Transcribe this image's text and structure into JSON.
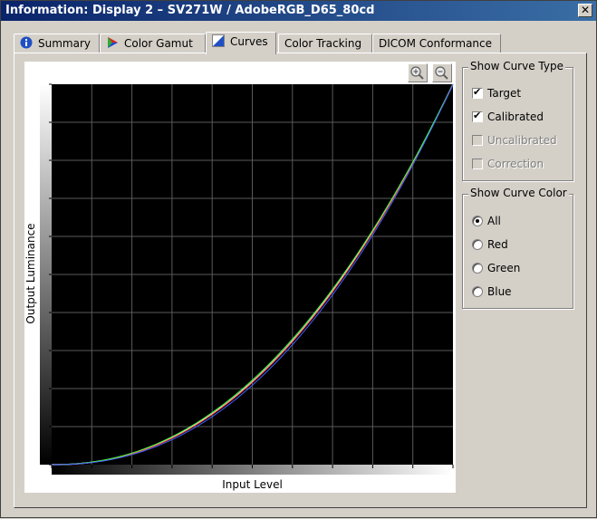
{
  "window": {
    "title": "Information: Display 2 – SV271W / AdobeRGB_D65_80cd",
    "close_glyph": "✕"
  },
  "tabs": [
    {
      "label": "Summary",
      "icon": "info-icon",
      "active": false
    },
    {
      "label": "Color Gamut",
      "icon": "color-gamut-icon",
      "active": false
    },
    {
      "label": "Curves",
      "icon": "curves-icon",
      "active": true
    },
    {
      "label": "Color Tracking",
      "icon": "",
      "active": false
    },
    {
      "label": "DICOM Conformance",
      "icon": "",
      "active": false
    }
  ],
  "plot": {
    "zoom_in_icon": "zoom-in-icon",
    "zoom_out_icon": "zoom-out-icon",
    "background": "#000000",
    "grid_color": "#5a5a5a"
  },
  "chart_data": {
    "type": "line",
    "xlabel": "Input Level",
    "ylabel": "Output Luminance",
    "xlim": [
      0,
      1
    ],
    "ylim": [
      0,
      1
    ],
    "grid": true,
    "series": [
      {
        "color": "#ffffff",
        "gamma": 2.2,
        "x": [
          0,
          0.1,
          0.2,
          0.3,
          0.4,
          0.5,
          0.6,
          0.7,
          0.8,
          0.9,
          1.0
        ],
        "y": [
          0.0,
          0.006,
          0.029,
          0.071,
          0.133,
          0.218,
          0.325,
          0.456,
          0.612,
          0.793,
          1.0
        ]
      },
      {
        "color": "#ff4040",
        "gamma": 2.21,
        "x": [
          0,
          0.1,
          0.2,
          0.3,
          0.4,
          0.5,
          0.6,
          0.7,
          0.8,
          0.9,
          1.0
        ],
        "y": [
          0.0,
          0.006,
          0.029,
          0.07,
          0.132,
          0.216,
          0.324,
          0.455,
          0.611,
          0.792,
          1.0
        ]
      },
      {
        "color": "#40ff40",
        "gamma": 2.17,
        "x": [
          0,
          0.1,
          0.2,
          0.3,
          0.4,
          0.5,
          0.6,
          0.7,
          0.8,
          0.9,
          1.0
        ],
        "y": [
          0.0,
          0.007,
          0.03,
          0.073,
          0.137,
          0.222,
          0.33,
          0.461,
          0.616,
          0.796,
          1.0
        ]
      },
      {
        "color": "#4060ff",
        "gamma": 2.26,
        "x": [
          0,
          0.1,
          0.2,
          0.3,
          0.4,
          0.5,
          0.6,
          0.7,
          0.8,
          0.9,
          1.0
        ],
        "y": [
          0.0,
          0.005,
          0.026,
          0.066,
          0.126,
          0.209,
          0.315,
          0.447,
          0.604,
          0.788,
          1.0
        ]
      }
    ]
  },
  "curve_type": {
    "title": "Show Curve Type",
    "options": [
      {
        "label": "Target",
        "checked": true,
        "enabled": true
      },
      {
        "label": "Calibrated",
        "checked": true,
        "enabled": true
      },
      {
        "label": "Uncalibrated",
        "checked": false,
        "enabled": false
      },
      {
        "label": "Correction",
        "checked": false,
        "enabled": false
      }
    ]
  },
  "curve_color": {
    "title": "Show Curve Color",
    "options": [
      {
        "label": "All",
        "selected": true
      },
      {
        "label": "Red",
        "selected": false
      },
      {
        "label": "Green",
        "selected": false
      },
      {
        "label": "Blue",
        "selected": false
      }
    ]
  },
  "check_glyph": "✔"
}
